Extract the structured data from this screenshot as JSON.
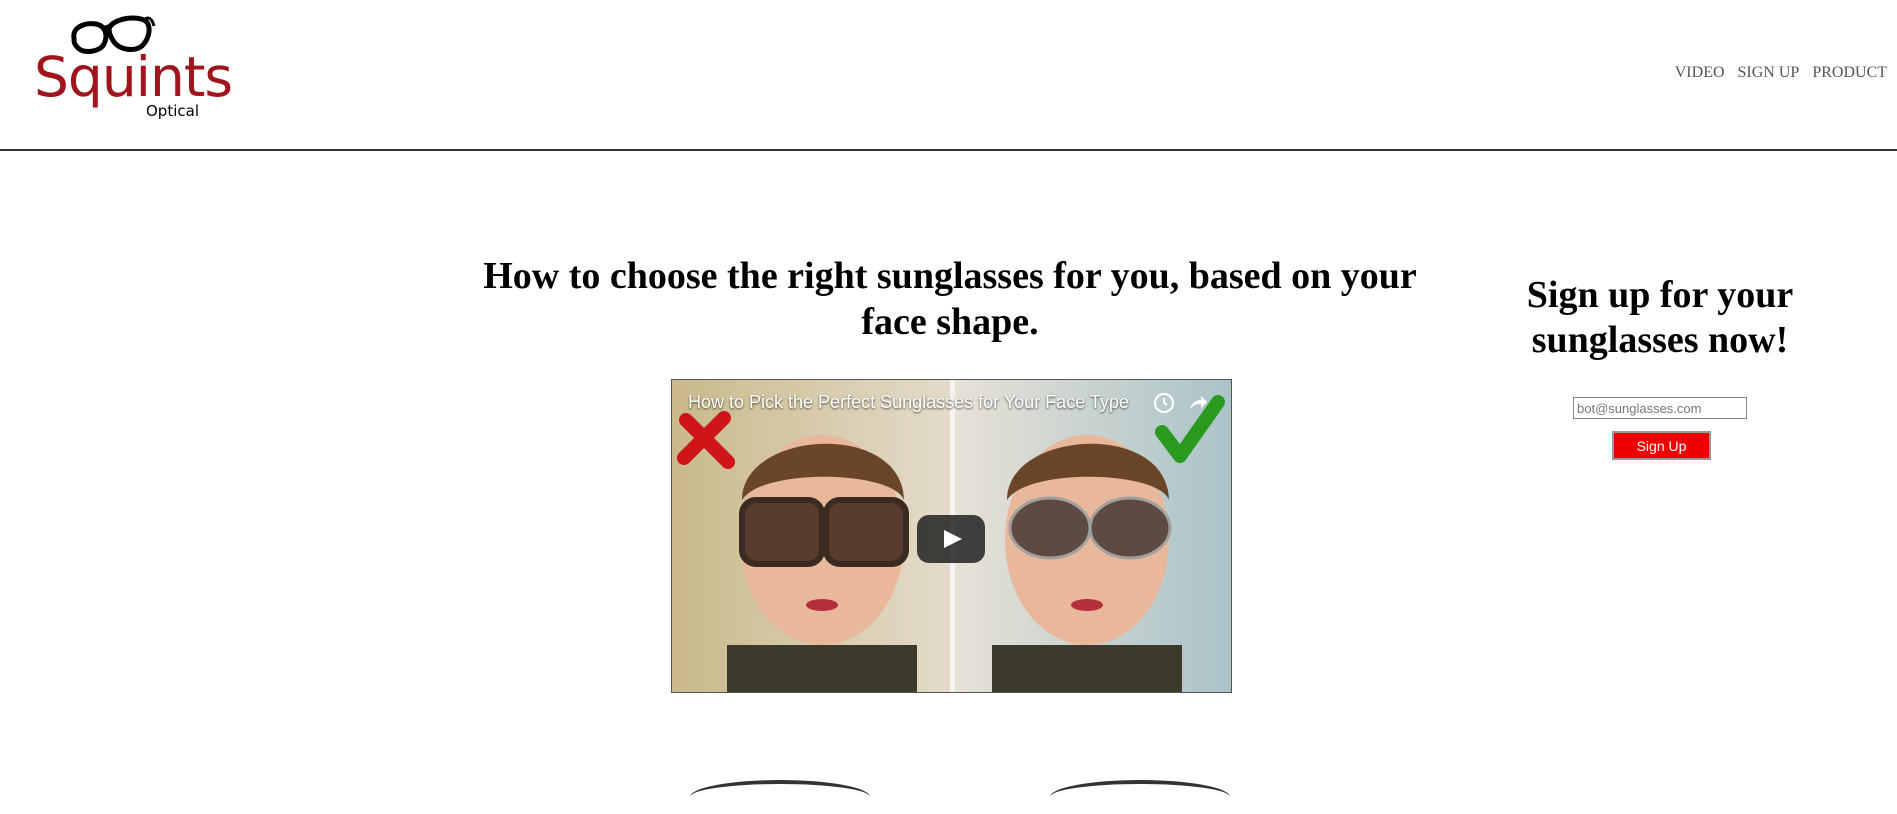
{
  "logo": {
    "wordmark": "Squints",
    "subtitle": "Optical",
    "color": "#a0151c"
  },
  "nav": {
    "items": [
      "VIDEO",
      "SIGN UP",
      "PRODUCT"
    ]
  },
  "main": {
    "title": "How to choose the right sunglasses for you, based on your face shape."
  },
  "video": {
    "title": "How to Pick the Perfect Sunglasses for Your Face Type",
    "icons": [
      "cross-mark-icon",
      "check-mark-icon",
      "watch-later-icon",
      "share-icon",
      "play-icon"
    ]
  },
  "signup": {
    "title": "Sign up for your sunglasses now!",
    "email_placeholder": "bot@sunglasses.com",
    "button_label": "Sign Up",
    "button_color": "#ee0000"
  }
}
